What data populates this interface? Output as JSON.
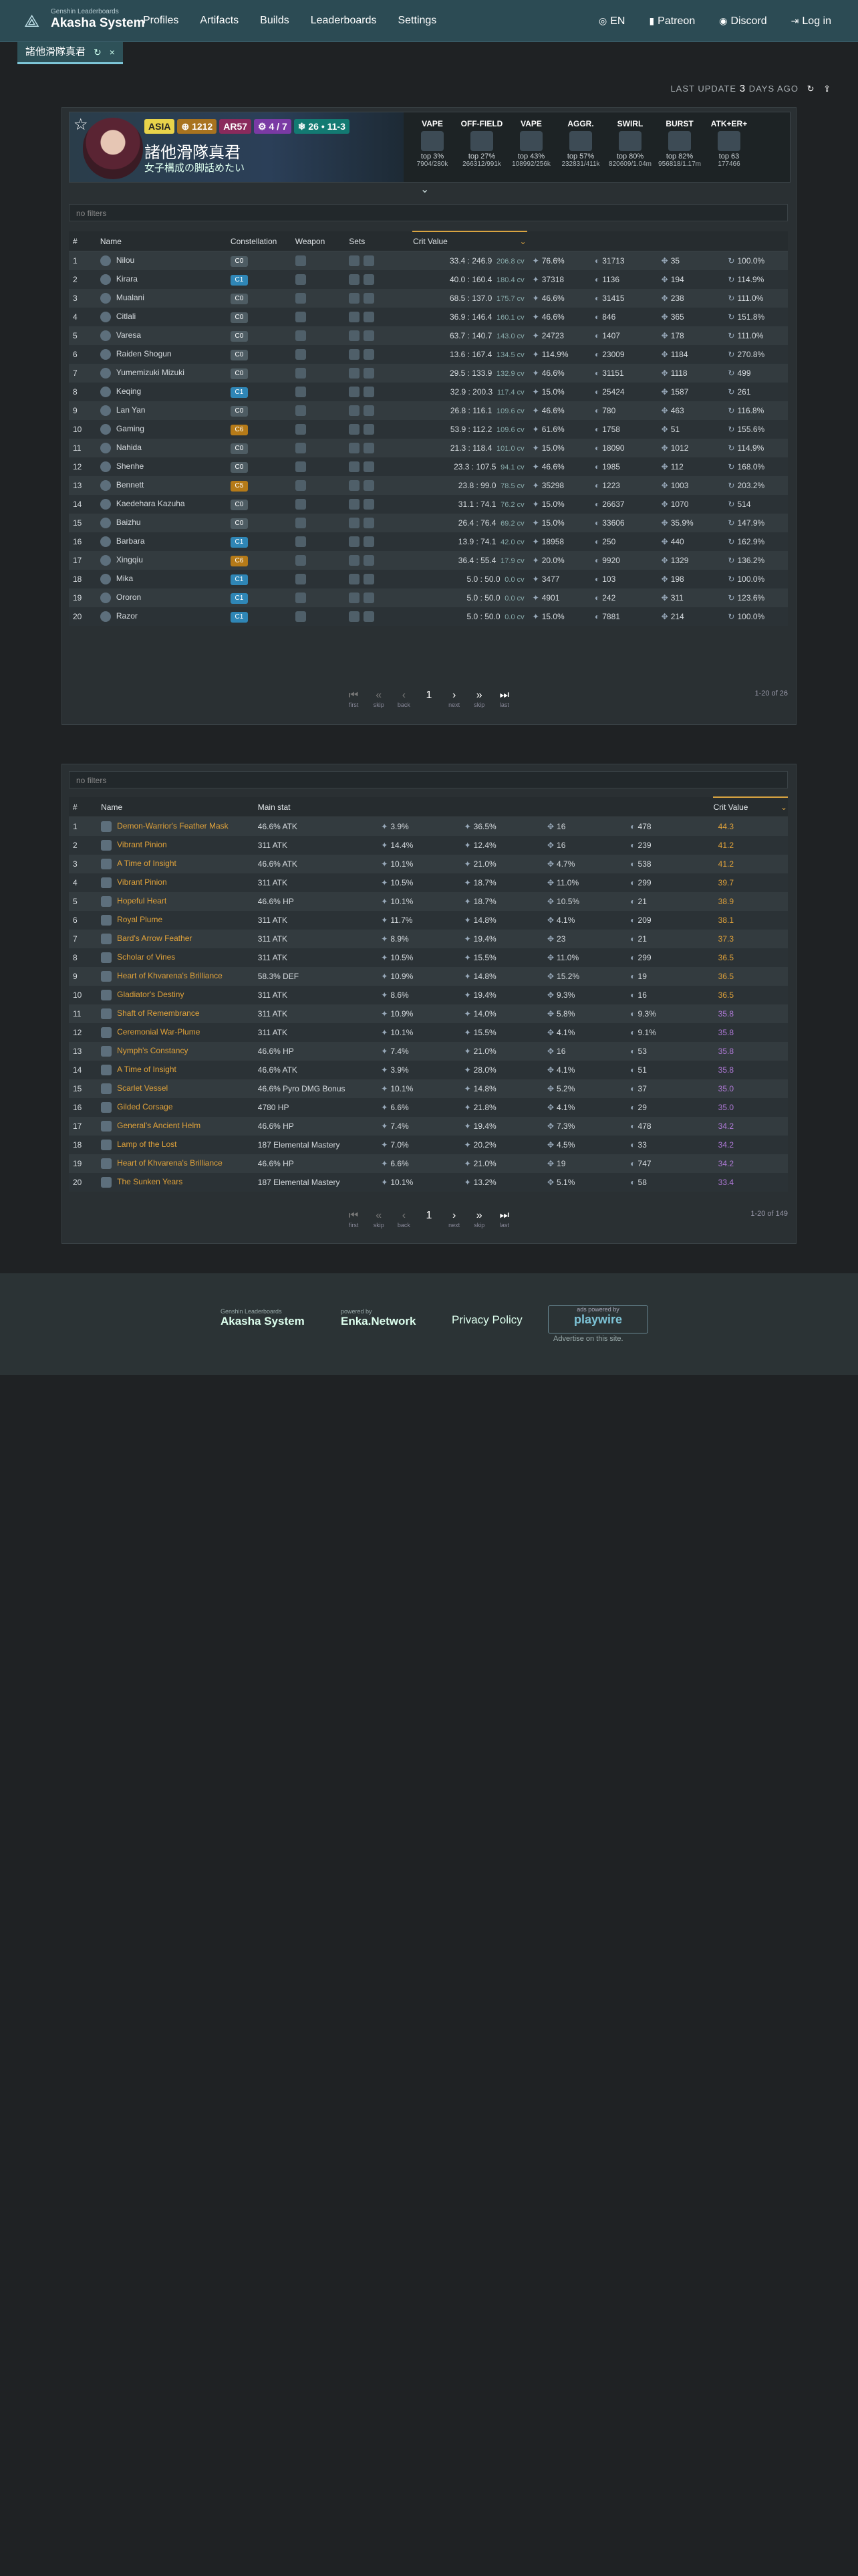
{
  "nav": {
    "brand_sub": "Genshin Leaderboards",
    "brand_name": "Akasha System",
    "links": [
      "Profiles",
      "Artifacts",
      "Builds",
      "Leaderboards",
      "Settings"
    ],
    "right": {
      "lang": "EN",
      "patreon": "Patreon",
      "discord": "Discord",
      "login": "Log in"
    }
  },
  "tab": {
    "label": "諸他滑隊真君"
  },
  "last_update": {
    "prefix": "LAST UPDATE",
    "value": "3",
    "suffix": "DAYS AGO"
  },
  "profile": {
    "region": "ASIA",
    "ar_level": "1212",
    "ar": "AR57",
    "abyss": "4 / 7",
    "theater": "26 • 11-3",
    "name": "諸他滑隊真君",
    "signature": "女子構成の脚話めたい",
    "rankings": [
      {
        "title": "VAPE",
        "top": "top 3%",
        "pos": "7904",
        "total": "/280k"
      },
      {
        "title": "OFF-FIELD",
        "top": "top 27%",
        "pos": "266312",
        "total": "/991k"
      },
      {
        "title": "VAPE",
        "top": "top 43%",
        "pos": "108992",
        "total": "/256k"
      },
      {
        "title": "AGGR.",
        "top": "top 57%",
        "pos": "232831",
        "total": "/411k"
      },
      {
        "title": "SWIRL",
        "top": "top 80%",
        "pos": "820609",
        "total": "/1.04m"
      },
      {
        "title": "BURST",
        "top": "top 82%",
        "pos": "956818",
        "total": "/1.17m"
      },
      {
        "title": "ATK+ER+",
        "top": "top 63",
        "pos": "177466",
        "total": ""
      }
    ]
  },
  "characters": {
    "filters_label": "no filters",
    "headers": [
      "#",
      "Name",
      "Constellation",
      "Weapon",
      "Sets",
      "Crit Value",
      "",
      "",
      "",
      ""
    ],
    "rows": [
      {
        "n": "1",
        "name": "Nilou",
        "c": "C0",
        "cls": "c0",
        "ratio": "33.4 : 246.9",
        "cv": "206.8 cv",
        "s1": "76.6%",
        "s2": "31713",
        "s3": "35",
        "s4": "100.0%"
      },
      {
        "n": "2",
        "name": "Kirara",
        "c": "C1",
        "cls": "c1",
        "ratio": "40.0 : 160.4",
        "cv": "180.4 cv",
        "s1": "37318",
        "s2": "1136",
        "s3": "194",
        "s4": "114.9%"
      },
      {
        "n": "3",
        "name": "Mualani",
        "c": "C0",
        "cls": "c0",
        "ratio": "68.5 : 137.0",
        "cv": "175.7 cv",
        "s1": "46.6%",
        "s2": "31415",
        "s3": "238",
        "s4": "111.0%"
      },
      {
        "n": "4",
        "name": "Citlali",
        "c": "C0",
        "cls": "c0",
        "ratio": "36.9 : 146.4",
        "cv": "160.1 cv",
        "s1": "46.6%",
        "s2": "846",
        "s3": "365",
        "s4": "151.8%"
      },
      {
        "n": "5",
        "name": "Varesa",
        "c": "C0",
        "cls": "c0",
        "ratio": "63.7 : 140.7",
        "cv": "143.0 cv",
        "s1": "24723",
        "s2": "1407",
        "s3": "178",
        "s4": "111.0%"
      },
      {
        "n": "6",
        "name": "Raiden Shogun",
        "c": "C0",
        "cls": "c0",
        "ratio": "13.6 : 167.4",
        "cv": "134.5 cv",
        "s1": "114.9%",
        "s2": "23009",
        "s3": "1184",
        "s4": "270.8%"
      },
      {
        "n": "7",
        "name": "Yumemizuki Mizuki",
        "c": "C0",
        "cls": "c0",
        "ratio": "29.5 : 133.9",
        "cv": "132.9 cv",
        "s1": "46.6%",
        "s2": "31151",
        "s3": "1118",
        "s4": "499"
      },
      {
        "n": "8",
        "name": "Keqing",
        "c": "C1",
        "cls": "c1",
        "ratio": "32.9 : 200.3",
        "cv": "117.4 cv",
        "s1": "15.0%",
        "s2": "25424",
        "s3": "1587",
        "s4": "261"
      },
      {
        "n": "9",
        "name": "Lan Yan",
        "c": "C0",
        "cls": "c0",
        "ratio": "26.8 : 116.1",
        "cv": "109.6 cv",
        "s1": "46.6%",
        "s2": "780",
        "s3": "463",
        "s4": "116.8%"
      },
      {
        "n": "10",
        "name": "Gaming",
        "c": "C6",
        "cls": "c2",
        "ratio": "53.9 : 112.2",
        "cv": "109.6 cv",
        "s1": "61.6%",
        "s2": "1758",
        "s3": "51",
        "s4": "155.6%"
      },
      {
        "n": "11",
        "name": "Nahida",
        "c": "C0",
        "cls": "c0",
        "ratio": "21.3 : 118.4",
        "cv": "101.0 cv",
        "s1": "15.0%",
        "s2": "18090",
        "s3": "1012",
        "s4": "114.9%"
      },
      {
        "n": "12",
        "name": "Shenhe",
        "c": "C0",
        "cls": "c0",
        "ratio": "23.3 : 107.5",
        "cv": "94.1 cv",
        "s1": "46.6%",
        "s2": "1985",
        "s3": "112",
        "s4": "168.0%"
      },
      {
        "n": "13",
        "name": "Bennett",
        "c": "C5",
        "cls": "c2",
        "ratio": "23.8 : 99.0",
        "cv": "78.5 cv",
        "s1": "35298",
        "s2": "1223",
        "s3": "1003",
        "s4": "203.2%"
      },
      {
        "n": "14",
        "name": "Kaedehara Kazuha",
        "c": "C0",
        "cls": "c0",
        "ratio": "31.1 : 74.1",
        "cv": "76.2 cv",
        "s1": "15.0%",
        "s2": "26637",
        "s3": "1070",
        "s4": "514"
      },
      {
        "n": "15",
        "name": "Baizhu",
        "c": "C0",
        "cls": "c0",
        "ratio": "26.4 : 76.4",
        "cv": "69.2 cv",
        "s1": "15.0%",
        "s2": "33606",
        "s3": "35.9%",
        "s4": "147.9%"
      },
      {
        "n": "16",
        "name": "Barbara",
        "c": "C1",
        "cls": "c1",
        "ratio": "13.9 : 74.1",
        "cv": "42.0 cv",
        "s1": "18958",
        "s2": "250",
        "s3": "440",
        "s4": "162.9%"
      },
      {
        "n": "17",
        "name": "Xingqiu",
        "c": "C6",
        "cls": "c2",
        "ratio": "36.4 : 55.4",
        "cv": "17.9 cv",
        "s1": "20.0%",
        "s2": "9920",
        "s3": "1329",
        "s4": "136.2%"
      },
      {
        "n": "18",
        "name": "Mika",
        "c": "C1",
        "cls": "c1",
        "ratio": "5.0 : 50.0",
        "cv": "0.0 cv",
        "s1": "3477",
        "s2": "103",
        "s3": "198",
        "s4": "100.0%"
      },
      {
        "n": "19",
        "name": "Ororon",
        "c": "C1",
        "cls": "c1",
        "ratio": "5.0 : 50.0",
        "cv": "0.0 cv",
        "s1": "4901",
        "s2": "242",
        "s3": "311",
        "s4": "123.6%"
      },
      {
        "n": "20",
        "name": "Razor",
        "c": "C1",
        "cls": "c1",
        "ratio": "5.0 : 50.0",
        "cv": "0.0 cv",
        "s1": "15.0%",
        "s2": "7881",
        "s3": "214",
        "s4": "100.0%"
      }
    ],
    "count": "1-20 of 26"
  },
  "pagination": {
    "first": "first",
    "skip_back": "skip",
    "back": "back",
    "page": "1",
    "next": "next",
    "skip_fwd": "skip",
    "last": "last"
  },
  "artifacts": {
    "filters_label": "no filters",
    "headers": [
      "#",
      "Name",
      "Main stat",
      "",
      "",
      "",
      "",
      "Crit Value"
    ],
    "rows": [
      {
        "n": "1",
        "name": "Demon-Warrior's Feather Mask",
        "main": "46.6% ATK",
        "a": "3.9%",
        "b": "36.5%",
        "c": "16",
        "d": "478",
        "cv": "44.3"
      },
      {
        "n": "2",
        "name": "Vibrant Pinion",
        "main": "311 ATK",
        "a": "14.4%",
        "b": "12.4%",
        "c": "16",
        "d": "239",
        "cv": "41.2"
      },
      {
        "n": "3",
        "name": "A Time of Insight",
        "main": "46.6% ATK",
        "a": "10.1%",
        "b": "21.0%",
        "c": "4.7%",
        "d": "538",
        "cv": "41.2"
      },
      {
        "n": "4",
        "name": "Vibrant Pinion",
        "main": "311 ATK",
        "a": "10.5%",
        "b": "18.7%",
        "c": "11.0%",
        "d": "299",
        "cv": "39.7"
      },
      {
        "n": "5",
        "name": "Hopeful Heart",
        "main": "46.6% HP",
        "a": "10.1%",
        "b": "18.7%",
        "c": "10.5%",
        "d": "21",
        "cv": "38.9"
      },
      {
        "n": "6",
        "name": "Royal Plume",
        "main": "311 ATK",
        "a": "11.7%",
        "b": "14.8%",
        "c": "4.1%",
        "d": "209",
        "cv": "38.1"
      },
      {
        "n": "7",
        "name": "Bard's Arrow Feather",
        "main": "311 ATK",
        "a": "8.9%",
        "b": "19.4%",
        "c": "23",
        "d": "21",
        "cv": "37.3"
      },
      {
        "n": "8",
        "name": "Scholar of Vines",
        "main": "311 ATK",
        "a": "10.5%",
        "b": "15.5%",
        "c": "11.0%",
        "d": "299",
        "cv": "36.5"
      },
      {
        "n": "9",
        "name": "Heart of Khvarena's Brilliance",
        "main": "58.3% DEF",
        "a": "10.9%",
        "b": "14.8%",
        "c": "15.2%",
        "d": "19",
        "cv": "36.5"
      },
      {
        "n": "10",
        "name": "Gladiator's Destiny",
        "main": "311 ATK",
        "a": "8.6%",
        "b": "19.4%",
        "c": "9.3%",
        "d": "16",
        "cv": "36.5"
      },
      {
        "n": "11",
        "name": "Shaft of Remembrance",
        "main": "311 ATK",
        "a": "10.9%",
        "b": "14.0%",
        "c": "5.8%",
        "d": "9.3%",
        "cv": "35.8"
      },
      {
        "n": "12",
        "name": "Ceremonial War-Plume",
        "main": "311 ATK",
        "a": "10.1%",
        "b": "15.5%",
        "c": "4.1%",
        "d": "9.1%",
        "cv": "35.8"
      },
      {
        "n": "13",
        "name": "Nymph's Constancy",
        "main": "46.6% HP",
        "a": "7.4%",
        "b": "21.0%",
        "c": "16",
        "d": "53",
        "cv": "35.8"
      },
      {
        "n": "14",
        "name": "A Time of Insight",
        "main": "46.6% ATK",
        "a": "3.9%",
        "b": "28.0%",
        "c": "4.1%",
        "d": "51",
        "cv": "35.8"
      },
      {
        "n": "15",
        "name": "Scarlet Vessel",
        "main": "46.6% Pyro DMG Bonus",
        "a": "10.1%",
        "b": "14.8%",
        "c": "5.2%",
        "d": "37",
        "cv": "35.0"
      },
      {
        "n": "16",
        "name": "Gilded Corsage",
        "main": "4780 HP",
        "a": "6.6%",
        "b": "21.8%",
        "c": "4.1%",
        "d": "29",
        "cv": "35.0"
      },
      {
        "n": "17",
        "name": "General's Ancient Helm",
        "main": "46.6% HP",
        "a": "7.4%",
        "b": "19.4%",
        "c": "7.3%",
        "d": "478",
        "cv": "34.2"
      },
      {
        "n": "18",
        "name": "Lamp of the Lost",
        "main": "187 Elemental Mastery",
        "a": "7.0%",
        "b": "20.2%",
        "c": "4.5%",
        "d": "33",
        "cv": "34.2"
      },
      {
        "n": "19",
        "name": "Heart of Khvarena's Brilliance",
        "main": "46.6% HP",
        "a": "6.6%",
        "b": "21.0%",
        "c": "19",
        "d": "747",
        "cv": "34.2"
      },
      {
        "n": "20",
        "name": "The Sunken Years",
        "main": "187 Elemental Mastery",
        "a": "10.1%",
        "b": "13.2%",
        "c": "5.1%",
        "d": "58",
        "cv": "33.4"
      }
    ],
    "count": "1-20 of 149"
  },
  "footer": {
    "akasha_sub": "Genshin Leaderboards",
    "akasha": "Akasha System",
    "enka_sub": "powered by",
    "enka": "Enka.Network",
    "privacy": "Privacy Policy",
    "ads_sub": "ads powered by",
    "ads": "playwire",
    "advertise": "Advertise on this site."
  }
}
